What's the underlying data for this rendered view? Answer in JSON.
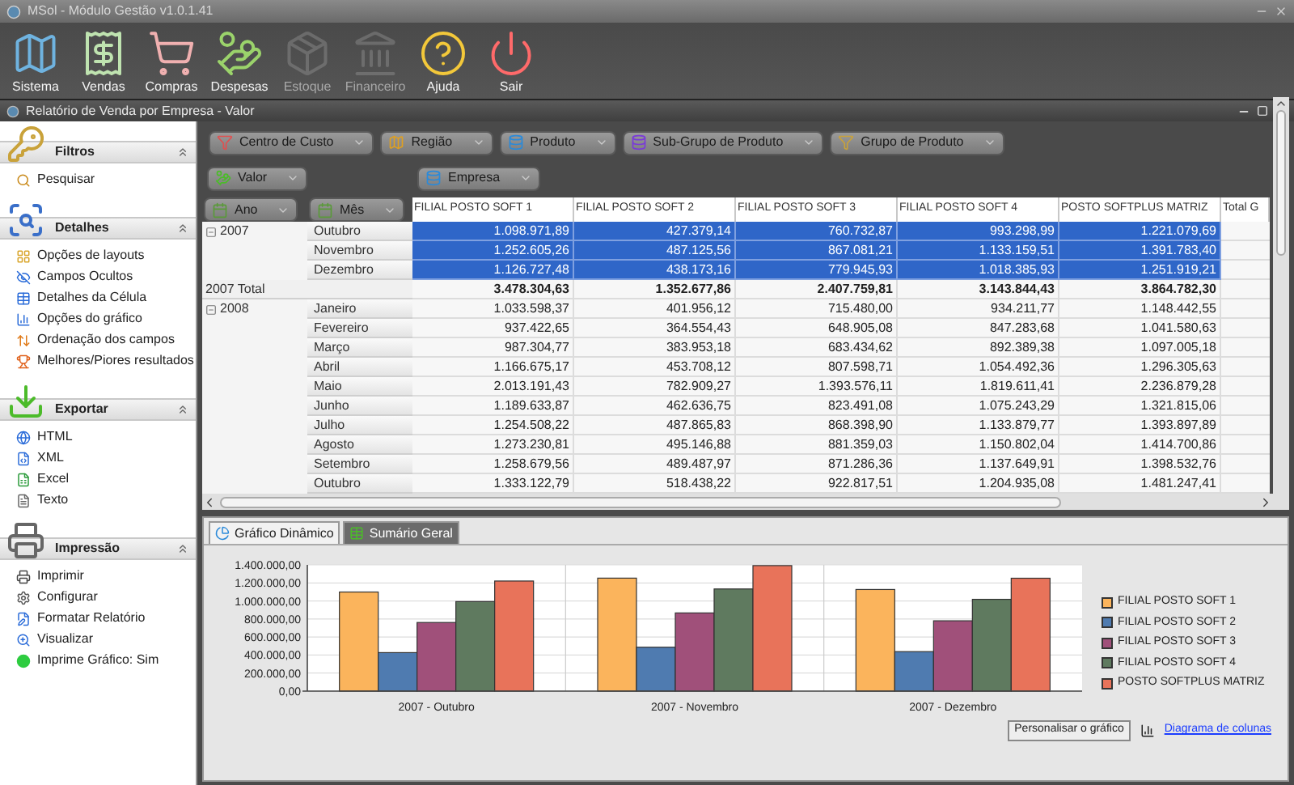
{
  "app": {
    "title": "MSol - Módulo Gestão v1.0.1.41"
  },
  "toolbar": [
    {
      "label": "Sistema",
      "disabled": false
    },
    {
      "label": "Vendas",
      "disabled": false
    },
    {
      "label": "Compras",
      "disabled": false
    },
    {
      "label": "Despesas",
      "disabled": false
    },
    {
      "label": "Estoque",
      "disabled": true
    },
    {
      "label": "Financeiro",
      "disabled": true
    },
    {
      "label": "Ajuda",
      "disabled": false
    },
    {
      "label": "Sair",
      "disabled": false
    }
  ],
  "report_window": {
    "title": "Relatório de Venda por Empresa - Valor"
  },
  "sidebar": {
    "sections": [
      {
        "title": "Filtros",
        "expanded": true,
        "items": [
          "Pesquisar"
        ]
      },
      {
        "title": "Detalhes",
        "expanded": true,
        "items": [
          "Opções de layouts",
          "Campos Ocultos",
          "Detalhes da Célula",
          "Opções do gráfico",
          "Ordenação dos campos",
          "Melhores/Piores resultados"
        ]
      },
      {
        "title": "Exportar",
        "expanded": true,
        "items": [
          "HTML",
          "XML",
          "Excel",
          "Texto"
        ]
      },
      {
        "title": "Impressão",
        "expanded": true,
        "items": [
          "Imprimir",
          "Configurar",
          "Formatar Relatório",
          "Visualizar",
          "Imprime Gráfico: Sim"
        ]
      }
    ]
  },
  "pivot": {
    "filter_fields": [
      "Centro de Custo",
      "Região",
      "Produto",
      "Sub-Grupo de Produto",
      "Grupo de Produto"
    ],
    "data_fields": [
      "Valor"
    ],
    "column_fields": [
      "Empresa"
    ],
    "row_fields": [
      "Ano",
      "Mês"
    ],
    "columns": [
      "FILIAL POSTO SOFT 1",
      "FILIAL POSTO SOFT 2",
      "FILIAL POSTO SOFT 3",
      "FILIAL POSTO SOFT 4",
      "POSTO SOFTPLUS MATRIZ",
      "Total G"
    ],
    "rows": [
      {
        "kind": "month",
        "year": "2007",
        "month": "Outubro",
        "selected": true,
        "values": [
          "1.098.971,89",
          "427.379,14",
          "760.732,87",
          "993.298,99",
          "1.221.079,69"
        ]
      },
      {
        "kind": "month",
        "month": "Novembro",
        "selected": true,
        "values": [
          "1.252.605,26",
          "487.125,56",
          "867.081,21",
          "1.133.159,51",
          "1.391.783,40"
        ]
      },
      {
        "kind": "month",
        "month": "Dezembro",
        "selected": true,
        "values": [
          "1.126.727,48",
          "438.173,16",
          "779.945,93",
          "1.018.385,93",
          "1.251.919,21"
        ]
      },
      {
        "kind": "total",
        "label": "2007 Total",
        "selected": false,
        "values": [
          "3.478.304,63",
          "1.352.677,86",
          "2.407.759,81",
          "3.143.844,43",
          "3.864.782,30"
        ]
      },
      {
        "kind": "month",
        "year": "2008",
        "month": "Janeiro",
        "selected": false,
        "values": [
          "1.033.598,37",
          "401.956,12",
          "715.480,00",
          "934.211,77",
          "1.148.442,55"
        ]
      },
      {
        "kind": "month",
        "month": "Fevereiro",
        "selected": false,
        "values": [
          "937.422,65",
          "364.554,43",
          "648.905,08",
          "847.283,68",
          "1.041.580,63"
        ]
      },
      {
        "kind": "month",
        "month": "Março",
        "selected": false,
        "values": [
          "987.304,77",
          "383.953,18",
          "683.434,62",
          "892.389,38",
          "1.097.005,18"
        ]
      },
      {
        "kind": "month",
        "month": "Abril",
        "selected": false,
        "values": [
          "1.166.675,17",
          "453.708,12",
          "807.598,71",
          "1.054.492,36",
          "1.296.305,63"
        ]
      },
      {
        "kind": "month",
        "month": "Maio",
        "selected": false,
        "values": [
          "2.013.191,43",
          "782.909,27",
          "1.393.576,11",
          "1.819.611,41",
          "2.236.879,28"
        ]
      },
      {
        "kind": "month",
        "month": "Junho",
        "selected": false,
        "values": [
          "1.189.633,87",
          "462.636,75",
          "823.491,08",
          "1.075.243,29",
          "1.321.815,06"
        ]
      },
      {
        "kind": "month",
        "month": "Julho",
        "selected": false,
        "values": [
          "1.254.508,22",
          "487.865,83",
          "868.398,90",
          "1.133.879,77",
          "1.393.897,89"
        ]
      },
      {
        "kind": "month",
        "month": "Agosto",
        "selected": false,
        "values": [
          "1.273.230,81",
          "495.146,88",
          "881.359,03",
          "1.150.802,04",
          "1.414.700,86"
        ]
      },
      {
        "kind": "month",
        "month": "Setembro",
        "selected": false,
        "values": [
          "1.258.679,56",
          "489.487,97",
          "871.286,36",
          "1.137.649,91",
          "1.398.532,76"
        ]
      },
      {
        "kind": "month",
        "month": "Outubro",
        "selected": false,
        "values": [
          "1.333.122,79",
          "518.438,22",
          "922.817,51",
          "1.204.935,08",
          "1.481.247,41"
        ]
      }
    ]
  },
  "bottom_panel": {
    "tabs": [
      {
        "label": "Gráfico Dinâmico",
        "selected": true
      },
      {
        "label": "Sumário Geral",
        "selected": false
      }
    ],
    "chart_data": {
      "type": "bar",
      "categories": [
        "2007 - Outubro",
        "2007 - Novembro",
        "2007 - Dezembro"
      ],
      "series": [
        {
          "name": "FILIAL POSTO SOFT 1",
          "color": "#fbb45c",
          "values": [
            1099000,
            1253000,
            1127000
          ]
        },
        {
          "name": "FILIAL POSTO SOFT 2",
          "color": "#4f7bb0",
          "values": [
            427000,
            487000,
            438000
          ]
        },
        {
          "name": "FILIAL POSTO SOFT 3",
          "color": "#a0507a",
          "values": [
            761000,
            867000,
            780000
          ]
        },
        {
          "name": "FILIAL POSTO SOFT 4",
          "color": "#5f7a5f",
          "values": [
            993000,
            1133000,
            1018000
          ]
        },
        {
          "name": "POSTO SOFTPLUS MATRIZ",
          "color": "#e8735a",
          "values": [
            1221000,
            1392000,
            1252000
          ]
        }
      ],
      "ylim": [
        0,
        1400000
      ],
      "grid": true,
      "yticks": [
        {
          "value": 0,
          "label": "0,00"
        },
        {
          "value": 200000,
          "label": "200.000,00"
        },
        {
          "value": 400000,
          "label": "400.000,00"
        },
        {
          "value": 600000,
          "label": "600.000,00"
        },
        {
          "value": 800000,
          "label": "800.000,00"
        },
        {
          "value": 1000000,
          "label": "1.000.000,00"
        },
        {
          "value": 1200000,
          "label": "1.200.000,00"
        },
        {
          "value": 1400000,
          "label": "1.400.000,00"
        }
      ]
    },
    "customize_button": "Personalisar o gráfico",
    "chart_type_link": "Diagrama de colunas"
  }
}
